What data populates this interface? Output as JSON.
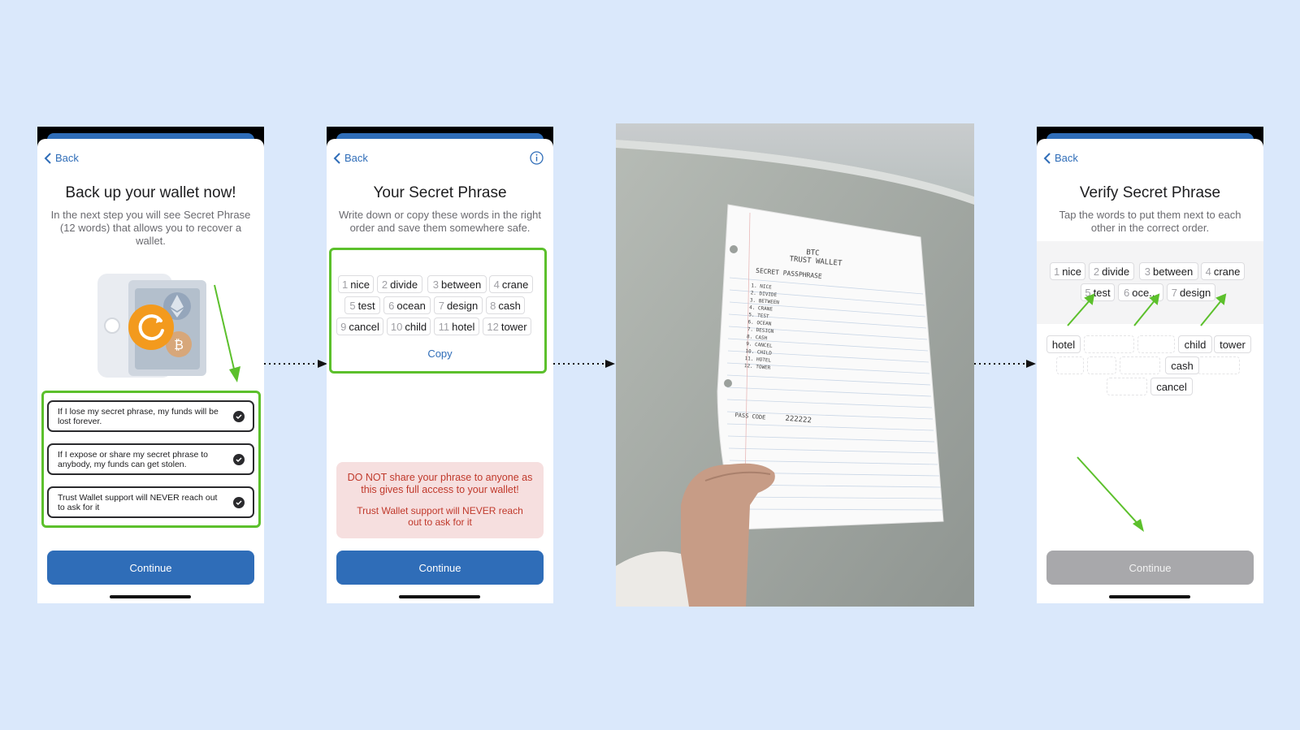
{
  "colors": {
    "background": "#dae8fb",
    "brand": "#2f6db8",
    "highlight_green": "#5cc02c",
    "warning_bg": "#f6dfdf",
    "warning_text": "#c0392b",
    "disabled": "#a8a8ab"
  },
  "screen1": {
    "back_label": "Back",
    "title": "Back up your wallet now!",
    "subtitle": "In the next step you will see Secret Phrase (12 words) that allows you to recover a wallet.",
    "checklist": [
      "If I lose my secret phrase, my funds will be lost forever.",
      "If I expose or share my secret phrase to anybody, my funds can get stolen.",
      "Trust Wallet support will NEVER reach out to ask for it"
    ],
    "continue_label": "Continue",
    "illustration_icons": [
      "safe-icon",
      "refresh-icon",
      "ethereum-icon",
      "bitcoin-icon"
    ]
  },
  "screen2": {
    "back_label": "Back",
    "info_icon": "info-icon",
    "title": "Your Secret Phrase",
    "subtitle": "Write down or copy these words in the right order and save them somewhere safe.",
    "words": [
      {
        "n": "1",
        "w": "nice"
      },
      {
        "n": "2",
        "w": "divide"
      },
      {
        "n": "3",
        "w": "between"
      },
      {
        "n": "4",
        "w": "crane"
      },
      {
        "n": "5",
        "w": "test"
      },
      {
        "n": "6",
        "w": "ocean"
      },
      {
        "n": "7",
        "w": "design"
      },
      {
        "n": "8",
        "w": "cash"
      },
      {
        "n": "9",
        "w": "cancel"
      },
      {
        "n": "10",
        "w": "child"
      },
      {
        "n": "11",
        "w": "hotel"
      },
      {
        "n": "12",
        "w": "tower"
      }
    ],
    "copy_label": "Copy",
    "warning_main": "DO NOT share your phrase to anyone as this gives full access to your wallet!",
    "warning_sub": "Trust Wallet support will NEVER reach out to ask for it",
    "continue_label": "Continue"
  },
  "photo": {
    "lines": [
      "BTC",
      "TRUST WALLET",
      "SECRET PASSPHRASE",
      "1. NICE",
      "2. DIVIDE",
      "3. BETWEEN",
      "4. CRANE",
      "5. TEST",
      "6. OCEAN",
      "7. DESIGN",
      "8. CASH",
      "9. CANCEL",
      "10. CHILD",
      "11. HOTEL",
      "12. TOWER",
      "PASS CODE",
      "222222"
    ]
  },
  "screen4": {
    "back_label": "Back",
    "title": "Verify Secret Phrase",
    "subtitle": "Tap the words to put them next to each other in the correct order.",
    "selected": [
      {
        "n": "1",
        "w": "nice"
      },
      {
        "n": "2",
        "w": "divide"
      },
      {
        "n": "3",
        "w": "between"
      },
      {
        "n": "4",
        "w": "crane"
      },
      {
        "n": "5",
        "w": "test"
      },
      {
        "n": "6",
        "w": "oce..."
      },
      {
        "n": "7",
        "w": "design"
      }
    ],
    "pool": [
      "hotel",
      "child",
      "tower",
      "cash",
      "cancel"
    ],
    "continue_label": "Continue"
  }
}
